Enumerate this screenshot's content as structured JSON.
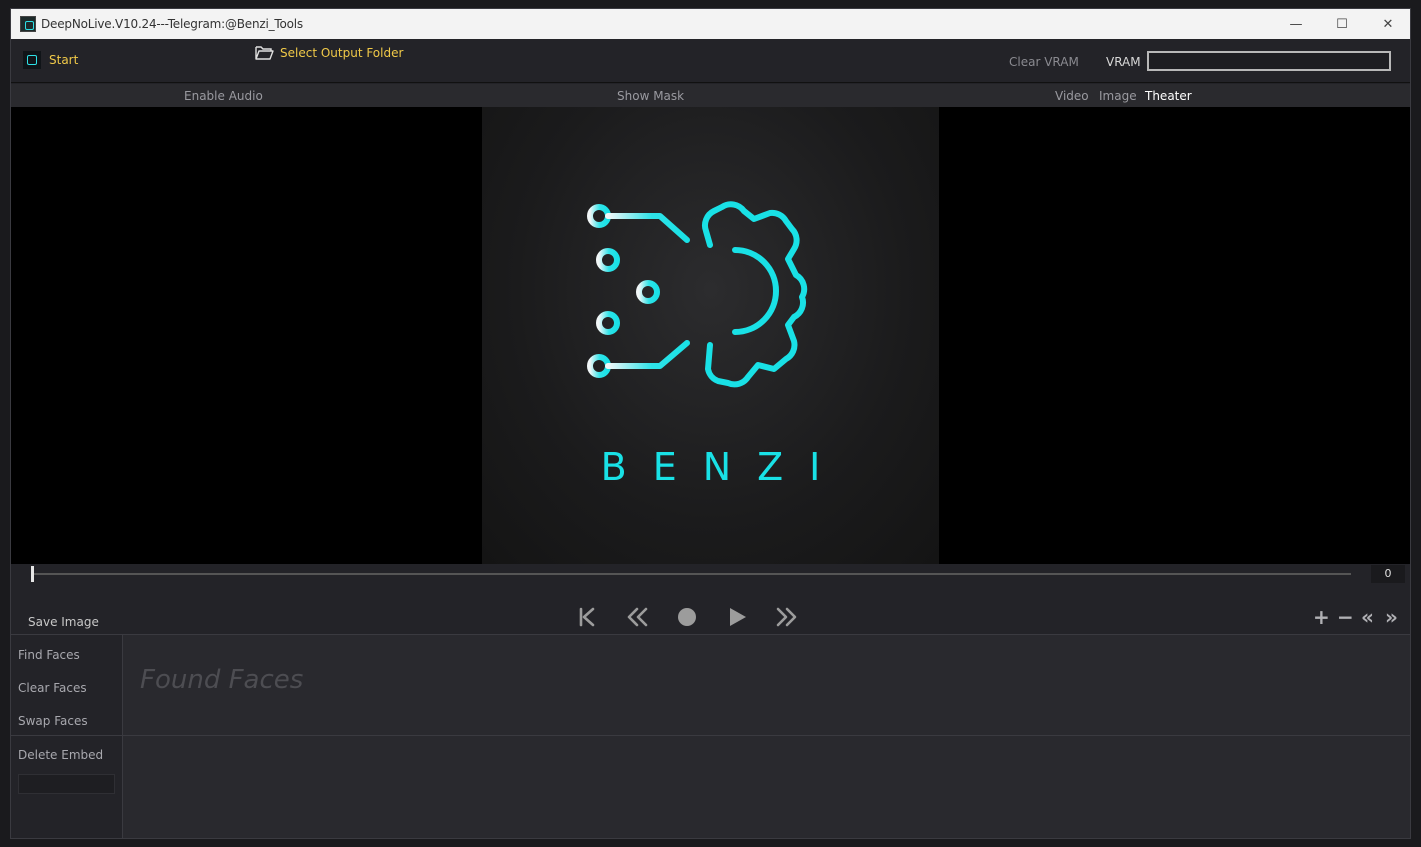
{
  "window": {
    "title": "DeepNoLive.V10.24---Telegram:@Benzi_Tools",
    "minimize": "—",
    "maximize": "☐",
    "close": "✕"
  },
  "toolbar": {
    "start_label": "Start",
    "select_output_label": "Select Output Folder",
    "clear_vram_label": "Clear VRAM",
    "vram_label": "VRAM",
    "vram_usage": 0
  },
  "subbar": {
    "enable_audio": "Enable Audio",
    "show_mask": "Show Mask",
    "video": "Video",
    "image": "Image",
    "theater": "Theater"
  },
  "viewer": {
    "brand_text": "BENZI"
  },
  "timeline": {
    "frame": "0"
  },
  "controls": {
    "save_image": "Save Image",
    "zoom_in": "+",
    "zoom_out": "−",
    "prev_fast": "«",
    "next_fast": "»"
  },
  "faces": {
    "find_faces": "Find Faces",
    "clear_faces": "Clear Faces",
    "swap_faces": "Swap Faces",
    "found_faces_placeholder": "Found Faces",
    "delete_embed": "Delete Embed"
  },
  "colors": {
    "accent_yellow": "#f0c948",
    "brand_cyan": "#19e1e6"
  }
}
